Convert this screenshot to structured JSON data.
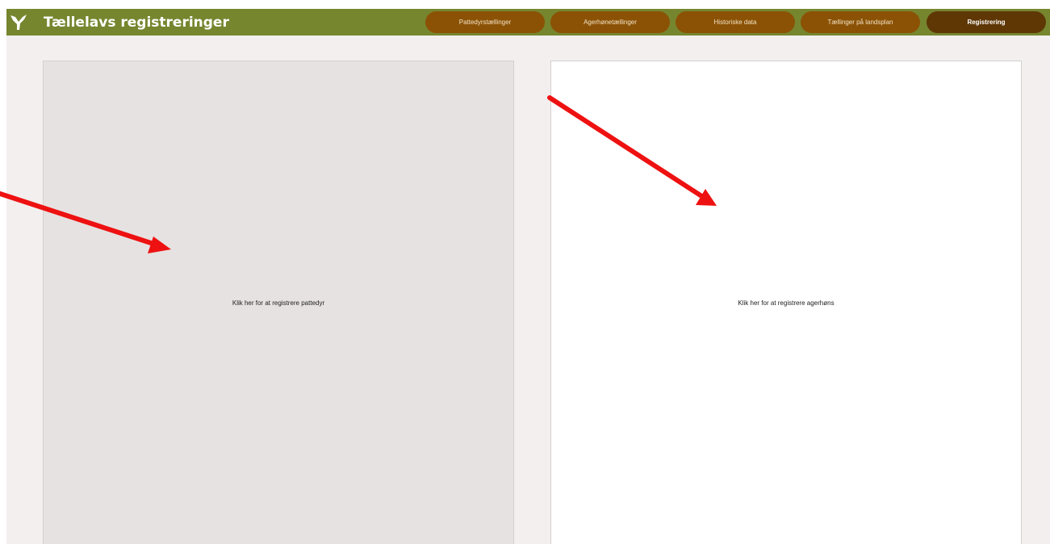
{
  "app": {
    "title": "Tællelavs registreringer",
    "logo_icon": "bird-logo-icon"
  },
  "nav": {
    "items": [
      {
        "label": "Pattedyrstællinger",
        "active": false
      },
      {
        "label": "Agerhønetællinger",
        "active": false
      },
      {
        "label": "Historiske data",
        "active": false
      },
      {
        "label": "Tællinger på landsplan",
        "active": false
      },
      {
        "label": "Registrering",
        "active": true
      }
    ]
  },
  "panels": {
    "mammals": {
      "label": "Klik her for at registrere pattedyr"
    },
    "partridge": {
      "label": "Klik her for at registrere agerhøns"
    }
  },
  "annotations": {
    "arrow_color": "#ee1111",
    "arrow_icon": "red-arrow-icon"
  },
  "colors": {
    "header": "#76862f",
    "nav_button": "#8b5205",
    "nav_button_active": "#5e3705",
    "page_background": "#f2efee",
    "panel_left": "#e6e2e1",
    "panel_right": "#ffffff"
  }
}
